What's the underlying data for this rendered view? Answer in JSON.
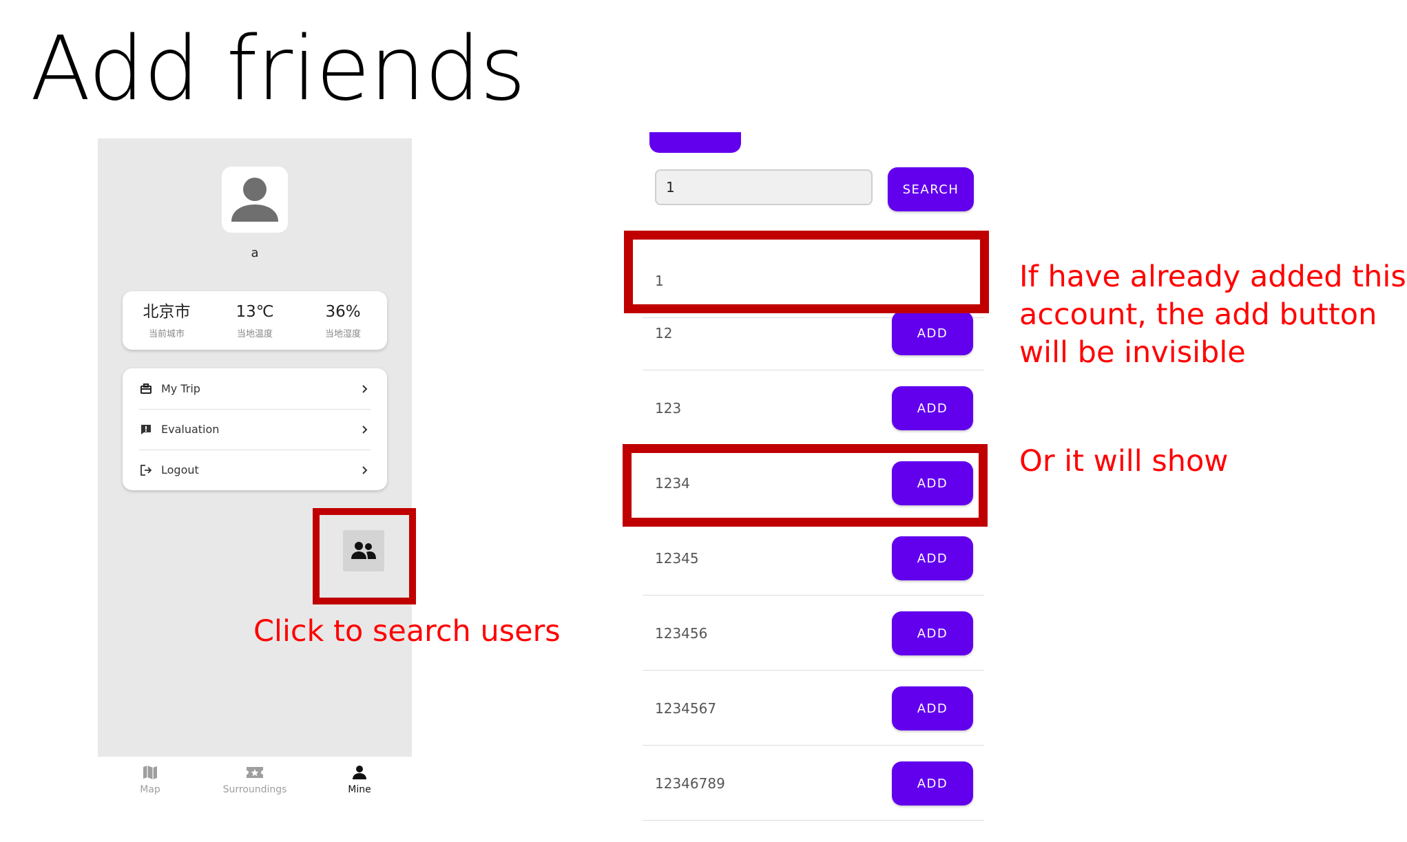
{
  "slide": {
    "title": "Add friends"
  },
  "left_screen": {
    "username": "a",
    "weather": [
      {
        "value": "北京市",
        "label": "当前城市"
      },
      {
        "value": "13℃",
        "label": "当地温度"
      },
      {
        "value": "36%",
        "label": "当地湿度"
      }
    ],
    "menu": [
      {
        "label": "My Trip",
        "icon": "briefcase-icon"
      },
      {
        "label": "Evaluation",
        "icon": "feedback-icon"
      },
      {
        "label": "Logout",
        "icon": "logout-icon"
      }
    ],
    "friends_button_icon": "people-icon",
    "nav": [
      {
        "label": "Map",
        "icon": "map-icon",
        "active": false
      },
      {
        "label": "Surroundings",
        "icon": "ticket-star-icon",
        "active": false
      },
      {
        "label": "Mine",
        "icon": "person-icon",
        "active": true
      }
    ]
  },
  "right_screen": {
    "search": {
      "value": "1",
      "button": "SEARCH"
    },
    "results": [
      {
        "name": "1",
        "button": null
      },
      {
        "name": "12",
        "button": "ADD"
      },
      {
        "name": "123",
        "button": "ADD"
      },
      {
        "name": "1234",
        "button": "ADD"
      },
      {
        "name": "12345",
        "button": "ADD"
      },
      {
        "name": "123456",
        "button": "ADD"
      },
      {
        "name": "1234567",
        "button": "ADD"
      },
      {
        "name": "12346789",
        "button": "ADD"
      }
    ]
  },
  "annotations": {
    "click_search": "Click to search users",
    "already_added": [
      "If have already added this",
      "account, the add button",
      "will be invisible"
    ],
    "or_show": "Or it will show"
  },
  "colors": {
    "accent": "#6200ee",
    "highlight": "#c00000",
    "annotation": "#ff0000"
  }
}
